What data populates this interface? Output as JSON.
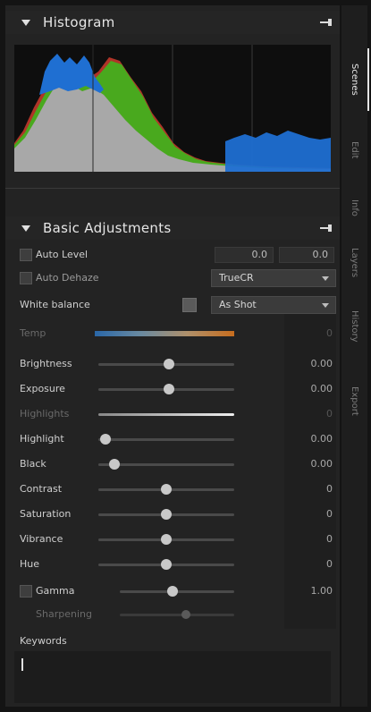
{
  "histogram": {
    "title": "Histogram"
  },
  "side_tabs": [
    {
      "label": "Scenes",
      "active": true
    },
    {
      "label": "Edit",
      "active": false
    },
    {
      "label": "Info",
      "active": false
    },
    {
      "label": "Layers",
      "active": false
    },
    {
      "label": "History",
      "active": false
    },
    {
      "label": "Export",
      "active": false
    }
  ],
  "basic": {
    "title": "Basic Adjustments",
    "autolevel_label": "Auto Level",
    "autolevel_value_1": "0.0",
    "autolevel_value_2": "0.0",
    "dehaze_label": "Auto Dehaze",
    "dehaze_mode": "TrueCR",
    "white_balance_label": "White balance",
    "white_balance_mode": "As Shot",
    "temp_label": "Temp",
    "temp_value": "0",
    "sliders": [
      {
        "label": "Brightness",
        "value": "0.00",
        "pos": 0.52,
        "dim": false
      },
      {
        "label": "Exposure",
        "value": "0.00",
        "pos": 0.52,
        "dim": false
      },
      {
        "label": "Highlights",
        "value": "0",
        "pos": 0.98,
        "dim": true
      },
      {
        "label": "Highlight",
        "value": "0.00",
        "pos": 0.05,
        "dim": false
      },
      {
        "label": "Black",
        "value": "0.00",
        "pos": 0.12,
        "dim": false
      },
      {
        "label": "Contrast",
        "value": "0",
        "pos": 0.5,
        "dim": false
      },
      {
        "label": "Saturation",
        "value": "0",
        "pos": 0.5,
        "dim": false
      },
      {
        "label": "Vibrance",
        "value": "0",
        "pos": 0.5,
        "dim": false
      },
      {
        "label": "Hue",
        "value": "0",
        "pos": 0.5,
        "dim": false
      }
    ],
    "gamma_label": "Gamma",
    "gamma_value": "1.00",
    "gamma_pos": 0.46,
    "dimmed_label": "Sharpening",
    "dimmed_pos": 0.58,
    "keywords_label": "Keywords"
  },
  "colors": {
    "blue": "#1e6fd0",
    "green": "#4aae1f",
    "red": "#c83a2a",
    "gray": "#a9a9a9"
  }
}
